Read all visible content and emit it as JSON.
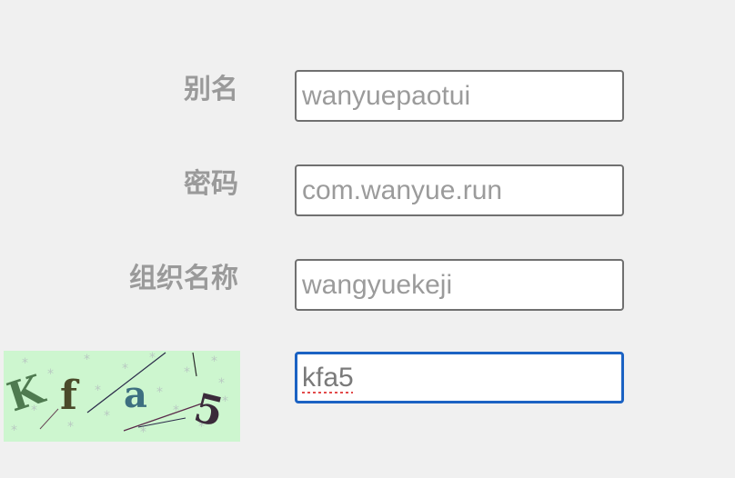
{
  "form": {
    "alias_label": "别名",
    "alias_value": "wanyuepaotui",
    "password_label": "密码",
    "password_value": "com.wanyue.run",
    "org_label": "组织名称",
    "org_value": "wangyuekeji",
    "captcha_value": "kfa5"
  },
  "captcha": {
    "chars": [
      "K",
      "f",
      "a",
      "5"
    ],
    "char_colors": [
      "#4f7a50",
      "#4a4a2a",
      "#3d6f80",
      "#3a2a3a"
    ],
    "background_color": "#cdf6cf"
  },
  "colors": {
    "page_background": "#f0f0f0",
    "label_text": "#9a9a9a",
    "input_border": "#707070",
    "focus_border": "#1b62c3"
  }
}
